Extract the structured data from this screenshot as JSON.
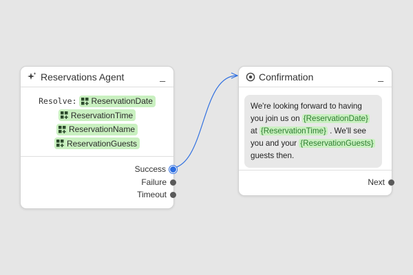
{
  "agent_node": {
    "title": "Reservations Agent",
    "minimize_label": "_",
    "resolve_label": "Resolve:",
    "variables": [
      "ReservationDate",
      "ReservationTime",
      "ReservationName",
      "ReservationGuests"
    ],
    "ports": [
      "Success",
      "Failure",
      "Timeout"
    ]
  },
  "confirmation_node": {
    "title": "Confirmation",
    "minimize_label": "_",
    "message": {
      "t1": "We're looking forward to having you join us on ",
      "v1": "{ReservationDate}",
      "t2": " at ",
      "v2": "{ReservationTime}",
      "t3": " . We'll see you and your ",
      "v3": "{ReservationGuests}",
      "t4": " guests then."
    },
    "port": "Next"
  },
  "colors": {
    "canvas": "#e6e6e6",
    "variable_chip": "#c9f0c0",
    "connection": "#2f6fe0"
  }
}
